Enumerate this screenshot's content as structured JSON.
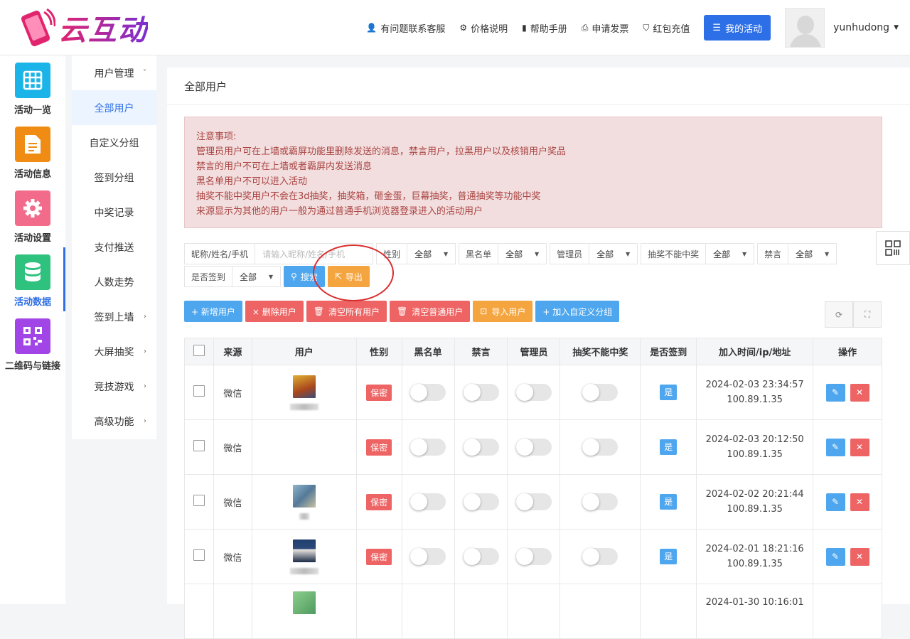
{
  "brand": {
    "name": "云互动"
  },
  "topnav": {
    "links": [
      {
        "icon": "user-plus-icon",
        "label": "有问题联系客服"
      },
      {
        "icon": "gear-icon",
        "label": "价格说明"
      },
      {
        "icon": "book-icon",
        "label": "帮助手册"
      },
      {
        "icon": "printer-icon",
        "label": "申请发票"
      },
      {
        "icon": "shield-check-icon",
        "label": "红包充值"
      }
    ],
    "my_activity": "我的活动",
    "username": "yunhudong"
  },
  "leftbar": {
    "items": [
      {
        "label": "活动一览",
        "color": "#1ab4e8",
        "icon": "grid-icon"
      },
      {
        "label": "活动信息",
        "color": "#f08c14",
        "icon": "document-icon"
      },
      {
        "label": "活动设置",
        "color": "#f26b8a",
        "icon": "gear-icon"
      },
      {
        "label": "活动数据",
        "color": "#2ec27e",
        "icon": "database-icon",
        "active": true
      },
      {
        "label": "二维码与链接",
        "color": "#a245e6",
        "icon": "qrcode-icon"
      }
    ]
  },
  "submenu": {
    "items": [
      {
        "label": "用户管理",
        "arrow": "down"
      },
      {
        "label": "全部用户",
        "active": true
      },
      {
        "label": "自定义分组"
      },
      {
        "label": "签到分组"
      },
      {
        "label": "中奖记录"
      },
      {
        "label": "支付推送"
      },
      {
        "label": "人数走势"
      },
      {
        "label": "签到上墙",
        "arrow": "right"
      },
      {
        "label": "大屏抽奖",
        "arrow": "right"
      },
      {
        "label": "竞技游戏",
        "arrow": "right"
      },
      {
        "label": "高级功能",
        "arrow": "right"
      }
    ]
  },
  "main": {
    "title": "全部用户",
    "notice": [
      "注意事项:",
      "管理员用户可在上墙或霸屏功能里删除发送的消息，禁言用户，拉黑用户以及核销用户奖品",
      "禁言的用户不可在上墙或者霸屏内发送消息",
      "黑名单用户不可以进入活动",
      "抽奖不能中奖用户不会在3d抽奖，抽奖箱，砸金蛋，巨幕抽奖，普通抽奖等功能中奖",
      "来源显示为其他的用户一般为通过普通手机浏览器登录进入的活动用户"
    ],
    "filters": {
      "keyword_label": "昵称/姓名/手机",
      "keyword_placeholder": "请输入昵称/姓名/手机",
      "selects": [
        {
          "label": "性别",
          "value": "全部"
        },
        {
          "label": "黑名单",
          "value": "全部"
        },
        {
          "label": "管理员",
          "value": "全部"
        },
        {
          "label": "抽奖不能中奖",
          "value": "全部"
        },
        {
          "label": "禁言",
          "value": "全部"
        }
      ],
      "signin": {
        "label": "是否签到",
        "value": "全部"
      },
      "search": "搜索",
      "export": "导出"
    },
    "actions": [
      {
        "label": "+ 新增用户",
        "style": "blue"
      },
      {
        "label": "× 删除用户",
        "style": "red"
      },
      {
        "label": "清空所有用户",
        "style": "red"
      },
      {
        "label": "清空普通用户",
        "style": "red"
      },
      {
        "label": "导入用户",
        "style": "orange"
      },
      {
        "label": "+ 加入自定义分组",
        "style": "blue"
      }
    ],
    "table": {
      "headers": [
        "来源",
        "用户",
        "性别",
        "黑名单",
        "禁言",
        "管理员",
        "抽奖不能中奖",
        "是否签到",
        "加入时间/ip/地址",
        "操作"
      ],
      "rows": [
        {
          "source": "微信",
          "avatar_color": "#c99a2e",
          "gender": "保密",
          "signed": "是",
          "time": "2024-02-03 23:34:57",
          "ip": "100.89.1.35"
        },
        {
          "source": "微信",
          "avatar_color": "",
          "gender": "保密",
          "signed": "是",
          "time": "2024-02-03 20:12:50",
          "ip": "100.89.1.35"
        },
        {
          "source": "微信",
          "avatar_color": "#6a8fb0",
          "gender": "保密",
          "signed": "是",
          "time": "2024-02-02 20:21:44",
          "ip": "100.89.1.35"
        },
        {
          "source": "微信",
          "avatar_color": "#2b4a7a",
          "gender": "保密",
          "signed": "是",
          "time": "2024-02-01 18:21:16",
          "ip": "100.89.1.35"
        },
        {
          "source": "",
          "avatar_color": "#6fae6f",
          "gender": "",
          "signed": "",
          "time": "2024-01-30 10:16:01",
          "ip": ""
        }
      ]
    }
  }
}
